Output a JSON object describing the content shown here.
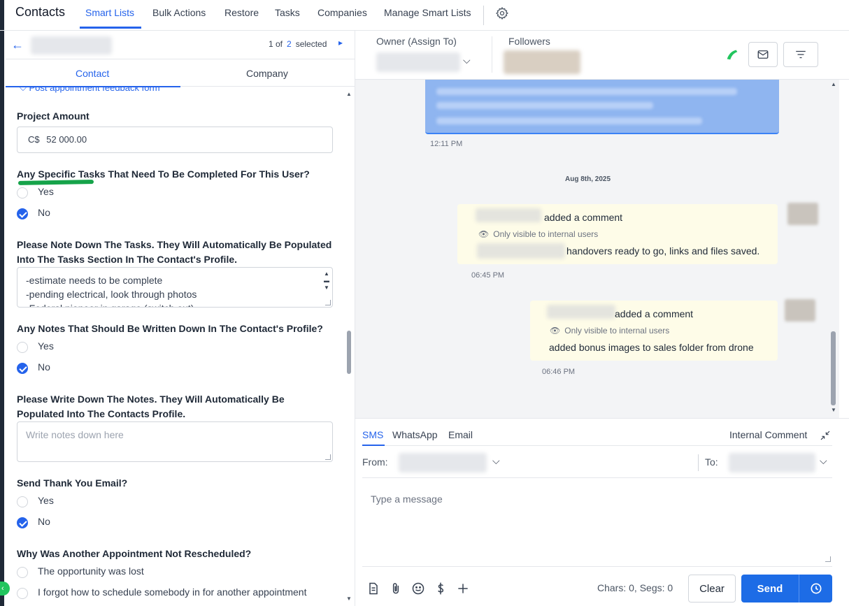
{
  "nav": {
    "title": "Contacts",
    "tabs": [
      "Smart Lists",
      "Bulk Actions",
      "Restore",
      "Tasks",
      "Companies",
      "Manage Smart Lists"
    ]
  },
  "record": {
    "pager_current": "1 of",
    "pager_total": "2",
    "pager_suffix": "selected",
    "tabs": [
      "Contact",
      "Company"
    ]
  },
  "form": {
    "section_link": "Post appointment feedback form",
    "project_amount": {
      "label": "Project Amount",
      "currency": "C$",
      "value": "52 000.00"
    },
    "q_tasks": {
      "label": "Any Specific Tasks That Need To Be Completed For This User?",
      "options": [
        "Yes",
        "No"
      ],
      "selected": "No"
    },
    "q_tasks_note": {
      "label": "Please Note Down The Tasks. They Will Automatically Be Populated Into The Tasks Section In The Contact's Profile.",
      "lines": [
        "-estimate needs to be complete",
        "-pending electrical, look through photos",
        "-Federal pioneer in garage (switch out)"
      ]
    },
    "q_notes": {
      "label": "Any Notes That Should Be Written Down In The Contact's Profile?",
      "options": [
        "Yes",
        "No"
      ],
      "selected": "No"
    },
    "q_notes_write": {
      "label": "Please Write Down The Notes. They Will Automatically Be Populated Into The Contacts Profile.",
      "placeholder": "Write notes down here"
    },
    "q_thanks": {
      "label": "Send Thank You Email?",
      "options": [
        "Yes",
        "No"
      ],
      "selected": "No"
    },
    "q_resched": {
      "label": "Why Was Another Appointment Not Rescheduled?",
      "options": [
        "The opportunity was lost",
        "I forgot how to schedule somebody in for another appointment"
      ]
    }
  },
  "conversation": {
    "owner_label": "Owner (Assign To)",
    "followers_label": "Followers",
    "first_time": "12:11 PM",
    "date_separator": "Aug 8th, 2025",
    "comments": [
      {
        "action": "added a comment",
        "visibility": "Only visible to internal users",
        "body": "handovers ready to go, links and files saved.",
        "time": "06:45 PM"
      },
      {
        "action": "added a comment",
        "visibility": "Only visible to internal users",
        "body": "added bonus images to sales folder from drone",
        "time": "06:46 PM"
      }
    ]
  },
  "composer": {
    "tabs": [
      "SMS",
      "WhatsApp",
      "Email"
    ],
    "internal_comment": "Internal Comment",
    "from_label": "From:",
    "to_label": "To:",
    "placeholder": "Type a message",
    "counts": "Chars: 0, Segs: 0",
    "clear_label": "Clear",
    "send_label": "Send"
  },
  "colors": {
    "accent": "#2563eb",
    "send": "#1d6ce6",
    "phone": "#22c55e",
    "comment_bg": "#fefce8",
    "annotation": "#16a34a"
  }
}
